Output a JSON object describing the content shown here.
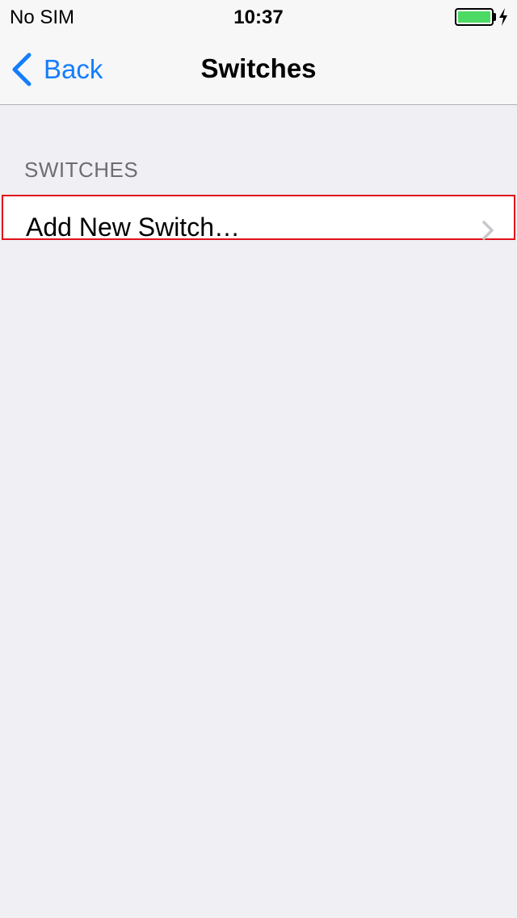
{
  "status_bar": {
    "carrier": "No SIM",
    "time": "10:37",
    "battery_level": 1.0,
    "battery_color": "#4cd964",
    "charging_icon": "lightning-bolt-icon"
  },
  "nav_bar": {
    "back_label": "Back",
    "back_icon": "chevron-left-icon",
    "title": "Switches",
    "tint_color": "#157efb"
  },
  "section": {
    "header": "SWITCHES",
    "rows": [
      {
        "label": "Add New Switch…",
        "accessory_icon": "chevron-right-icon"
      }
    ]
  },
  "highlight_color": "#e0101a"
}
